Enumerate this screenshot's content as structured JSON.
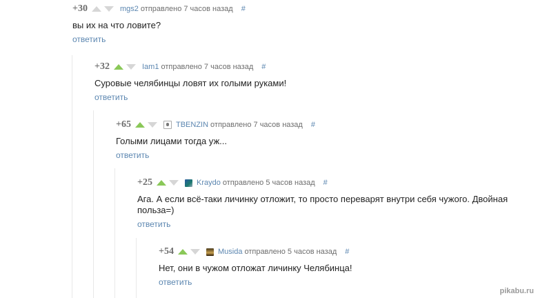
{
  "comments": [
    {
      "rating": "+30",
      "up_active": false,
      "author": "mgs2",
      "sent": "отправлено 7 часов назад",
      "hash": "#",
      "text": "вы их на что ловите?",
      "reply": "ответить"
    },
    {
      "rating": "+32",
      "up_active": true,
      "author": "Iam1",
      "sent": "отправлено 7 часов назад",
      "hash": "#",
      "text": "Суровые челябинцы ловят их голыми руками!",
      "reply": "ответить"
    },
    {
      "rating": "+65",
      "up_active": true,
      "author": "TBENZIN",
      "avatar": "tbenzin-avatar",
      "sent": "отправлено 7 часов назад",
      "hash": "#",
      "text": "Голыми лицами тогда уж...",
      "reply": "ответить"
    },
    {
      "rating": "+25",
      "up_active": true,
      "author": "Kraydo",
      "avatar": "kraydo-avatar",
      "sent": "отправлено 5 часов назад",
      "hash": "#",
      "text_line1": "Ага. А если всё-таки личинку отложит, то просто переварят внутри себя чужого. Двойная",
      "text_line2": "польза=)",
      "reply": "ответить"
    },
    {
      "rating": "+54",
      "up_active": true,
      "author": "Musida",
      "avatar": "musida-avatar",
      "sent": "отправлено 5 часов назад",
      "hash": "#",
      "text": "Нет, они в чужом отложат личинку Челябинца!",
      "reply": "ответить"
    }
  ],
  "watermark": "pikabu.ru",
  "colors": {
    "link": "#5b86b0",
    "upvote_active": "#8ac858",
    "vote_inactive": "#d6d6d6",
    "rating": "#6d6d6d"
  }
}
